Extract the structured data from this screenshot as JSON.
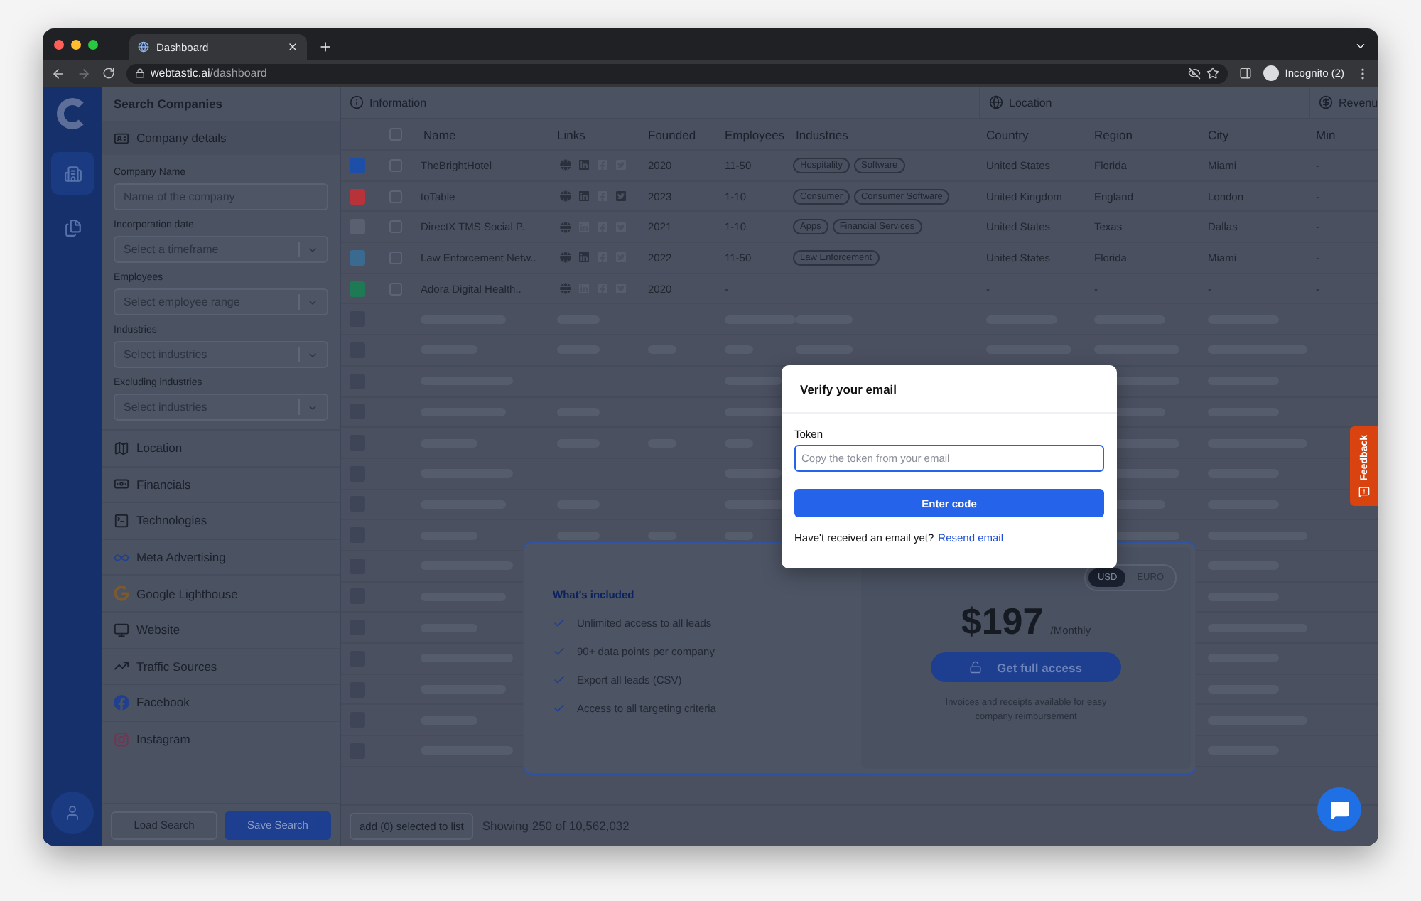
{
  "browser": {
    "tabs": [
      {
        "title": "Dashboard",
        "selected": true
      }
    ],
    "url_host": "webtastic.ai",
    "url_path": "/dashboard",
    "profile": "Incognito (2)"
  },
  "rail": {
    "items": [
      {
        "selected": true
      },
      {
        "selected": false
      }
    ]
  },
  "sidebar": {
    "title": "Search Companies",
    "section": {
      "label": "Company details"
    },
    "fields": [
      {
        "kind": "text",
        "label": "Company Name",
        "placeholder": "Name of the company"
      },
      {
        "kind": "select",
        "label": "Incorporation date",
        "placeholder": "Select a timeframe"
      },
      {
        "kind": "select",
        "label": "Employees",
        "placeholder": "Select employee range"
      },
      {
        "kind": "select",
        "label": "Industries",
        "placeholder": "Select industries"
      },
      {
        "kind": "select",
        "label": "Excluding industries",
        "placeholder": "Select industries"
      }
    ],
    "categories": [
      {
        "label": "Location"
      },
      {
        "label": "Financials"
      },
      {
        "label": "Technologies"
      },
      {
        "label": "Meta Advertising"
      },
      {
        "label": "Google Lighthouse"
      },
      {
        "label": "Website"
      },
      {
        "label": "Traffic Sources"
      },
      {
        "label": "Facebook"
      },
      {
        "label": "Instagram"
      }
    ],
    "buttons": [
      {
        "label": "Load Search",
        "kind": "secondary"
      },
      {
        "label": "Save Search",
        "kind": "primary"
      }
    ]
  },
  "table": {
    "groups": [
      {
        "label": "Information"
      },
      {
        "label": "Location"
      },
      {
        "label": "Revenu"
      }
    ],
    "select_all_checked": false,
    "columns": [
      "Name",
      "Links",
      "Founded",
      "Employees",
      "Industries",
      "Country",
      "Region",
      "City",
      "Min"
    ],
    "rows": [
      {
        "checked": false,
        "name": "TheBrightHotel",
        "links": [
          true,
          true,
          false,
          false
        ],
        "founded": "2020",
        "employees": "11-50",
        "industries": [
          "Hospitality",
          "Software"
        ],
        "country": "United States",
        "region": "Florida",
        "city": "Miami",
        "min": "-"
      },
      {
        "checked": false,
        "name": "toTable",
        "links": [
          true,
          true,
          false,
          true
        ],
        "founded": "2023",
        "employees": "1-10",
        "industries": [
          "Consumer",
          "Consumer Software"
        ],
        "country": "United Kingdom",
        "region": "England",
        "city": "London",
        "min": "-"
      },
      {
        "checked": false,
        "name": "DirectX TMS Social P..",
        "links": [
          true,
          false,
          false,
          false
        ],
        "founded": "2021",
        "employees": "1-10",
        "industries": [
          "Apps",
          "Financial Services"
        ],
        "country": "United States",
        "region": "Texas",
        "city": "Dallas",
        "min": "-"
      },
      {
        "checked": false,
        "name": "Law Enforcement Netw..",
        "links": [
          true,
          true,
          false,
          false
        ],
        "founded": "2022",
        "employees": "11-50",
        "industries": [
          "Law Enforcement"
        ],
        "country": "United States",
        "region": "Florida",
        "city": "Miami",
        "min": "-"
      },
      {
        "checked": false,
        "name": "Adora Digital Health..",
        "links": [
          true,
          false,
          false,
          false
        ],
        "founded": "2020",
        "employees": "-",
        "industries": [],
        "country": "-",
        "region": "-",
        "city": "-",
        "min": "-"
      }
    ],
    "footer": {
      "add_button": "add (0) selected to list",
      "count": "Showing 250 of 10,562,032"
    }
  },
  "pricing": {
    "included_title": "What's included",
    "features": [
      "Unlimited access to all leads",
      "90+ data points per company",
      "Export all leads (CSV)",
      "Access to all targeting criteria"
    ],
    "currencies": [
      {
        "label": "USD",
        "selected": true
      },
      {
        "label": "EURO",
        "selected": false
      }
    ],
    "price": "$197",
    "period": "/Monthly",
    "cta": "Get full access",
    "note": "Invoices and receipts available for easy company reimbursement"
  },
  "modal": {
    "title": "Verify your email",
    "field_label": "Token",
    "placeholder": "Copy the token from your email",
    "button": "Enter code",
    "footer_text": "Have't received an email yet?",
    "footer_link": "Resend email"
  },
  "feedback": {
    "label": "Feedback"
  }
}
